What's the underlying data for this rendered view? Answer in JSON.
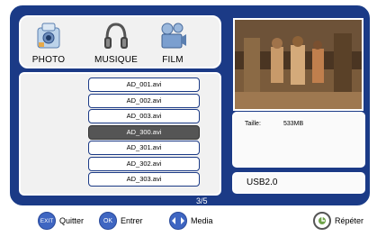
{
  "media_bar": {
    "items": [
      {
        "label": "PHOTO",
        "icon": "camera-icon"
      },
      {
        "label": "MUSIQUE",
        "icon": "headphones-icon"
      },
      {
        "label": "FILM",
        "icon": "film-projector-icon"
      }
    ]
  },
  "file_list": {
    "items": [
      "AD_001.avi",
      "AD_002.avi",
      "AD_003.avi",
      "AD_300.avi",
      "AD_301.avi",
      "AD_302.avi",
      "AD_303.avi"
    ],
    "selected_index": 3
  },
  "info": {
    "size_label": "Taille:",
    "size_value": "533MB"
  },
  "device": {
    "label": "USB2.0"
  },
  "pagination": {
    "text": "3/5"
  },
  "legend": {
    "exit_key": "EXIT",
    "exit_label": "Quitter",
    "ok_key": "OK",
    "ok_label": "Entrer",
    "media_label": "Media",
    "repeat_label": "Répéter"
  },
  "colors": {
    "frame": "#1b3a86",
    "panel": "#f1f1f1",
    "selected": "#555555",
    "button": "#3f66c2"
  }
}
